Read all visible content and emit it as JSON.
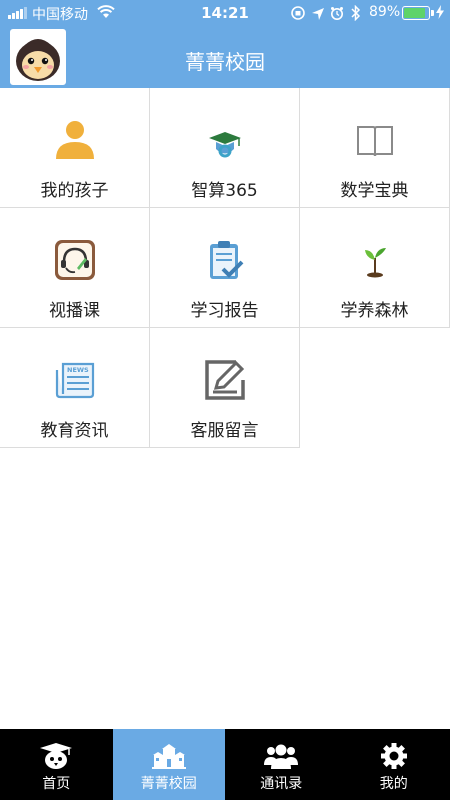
{
  "status_bar": {
    "carrier": "中国移动",
    "time": "14:21",
    "battery_percent": "89%",
    "battery_level": 0.89
  },
  "header": {
    "title": "菁菁校园"
  },
  "grid": {
    "items": [
      {
        "label": "我的孩子",
        "icon": "child-user-icon"
      },
      {
        "label": "智算365",
        "icon": "graduation-cap-icon"
      },
      {
        "label": "数学宝典",
        "icon": "open-book-icon"
      },
      {
        "label": "视播课",
        "icon": "headset-course-icon"
      },
      {
        "label": "学习报告",
        "icon": "clipboard-check-icon"
      },
      {
        "label": "学养森林",
        "icon": "sprout-icon"
      },
      {
        "label": "教育资讯",
        "icon": "newspaper-icon"
      },
      {
        "label": "客服留言",
        "icon": "edit-note-icon"
      }
    ]
  },
  "tabbar": {
    "tabs": [
      {
        "label": "首页",
        "icon": "home-mascot-icon"
      },
      {
        "label": "菁菁校园",
        "icon": "school-icon",
        "active": true
      },
      {
        "label": "通讯录",
        "icon": "contacts-icon"
      },
      {
        "label": "我的",
        "icon": "gear-icon"
      }
    ]
  },
  "colors": {
    "accent": "#6aaae4",
    "tabbar_bg": "#000000",
    "divider": "#dcdcdc",
    "battery_fill": "#5ed36a",
    "icon_orange": "#f0b03c",
    "icon_blue": "#5a9fd4",
    "icon_gray": "#777777"
  }
}
